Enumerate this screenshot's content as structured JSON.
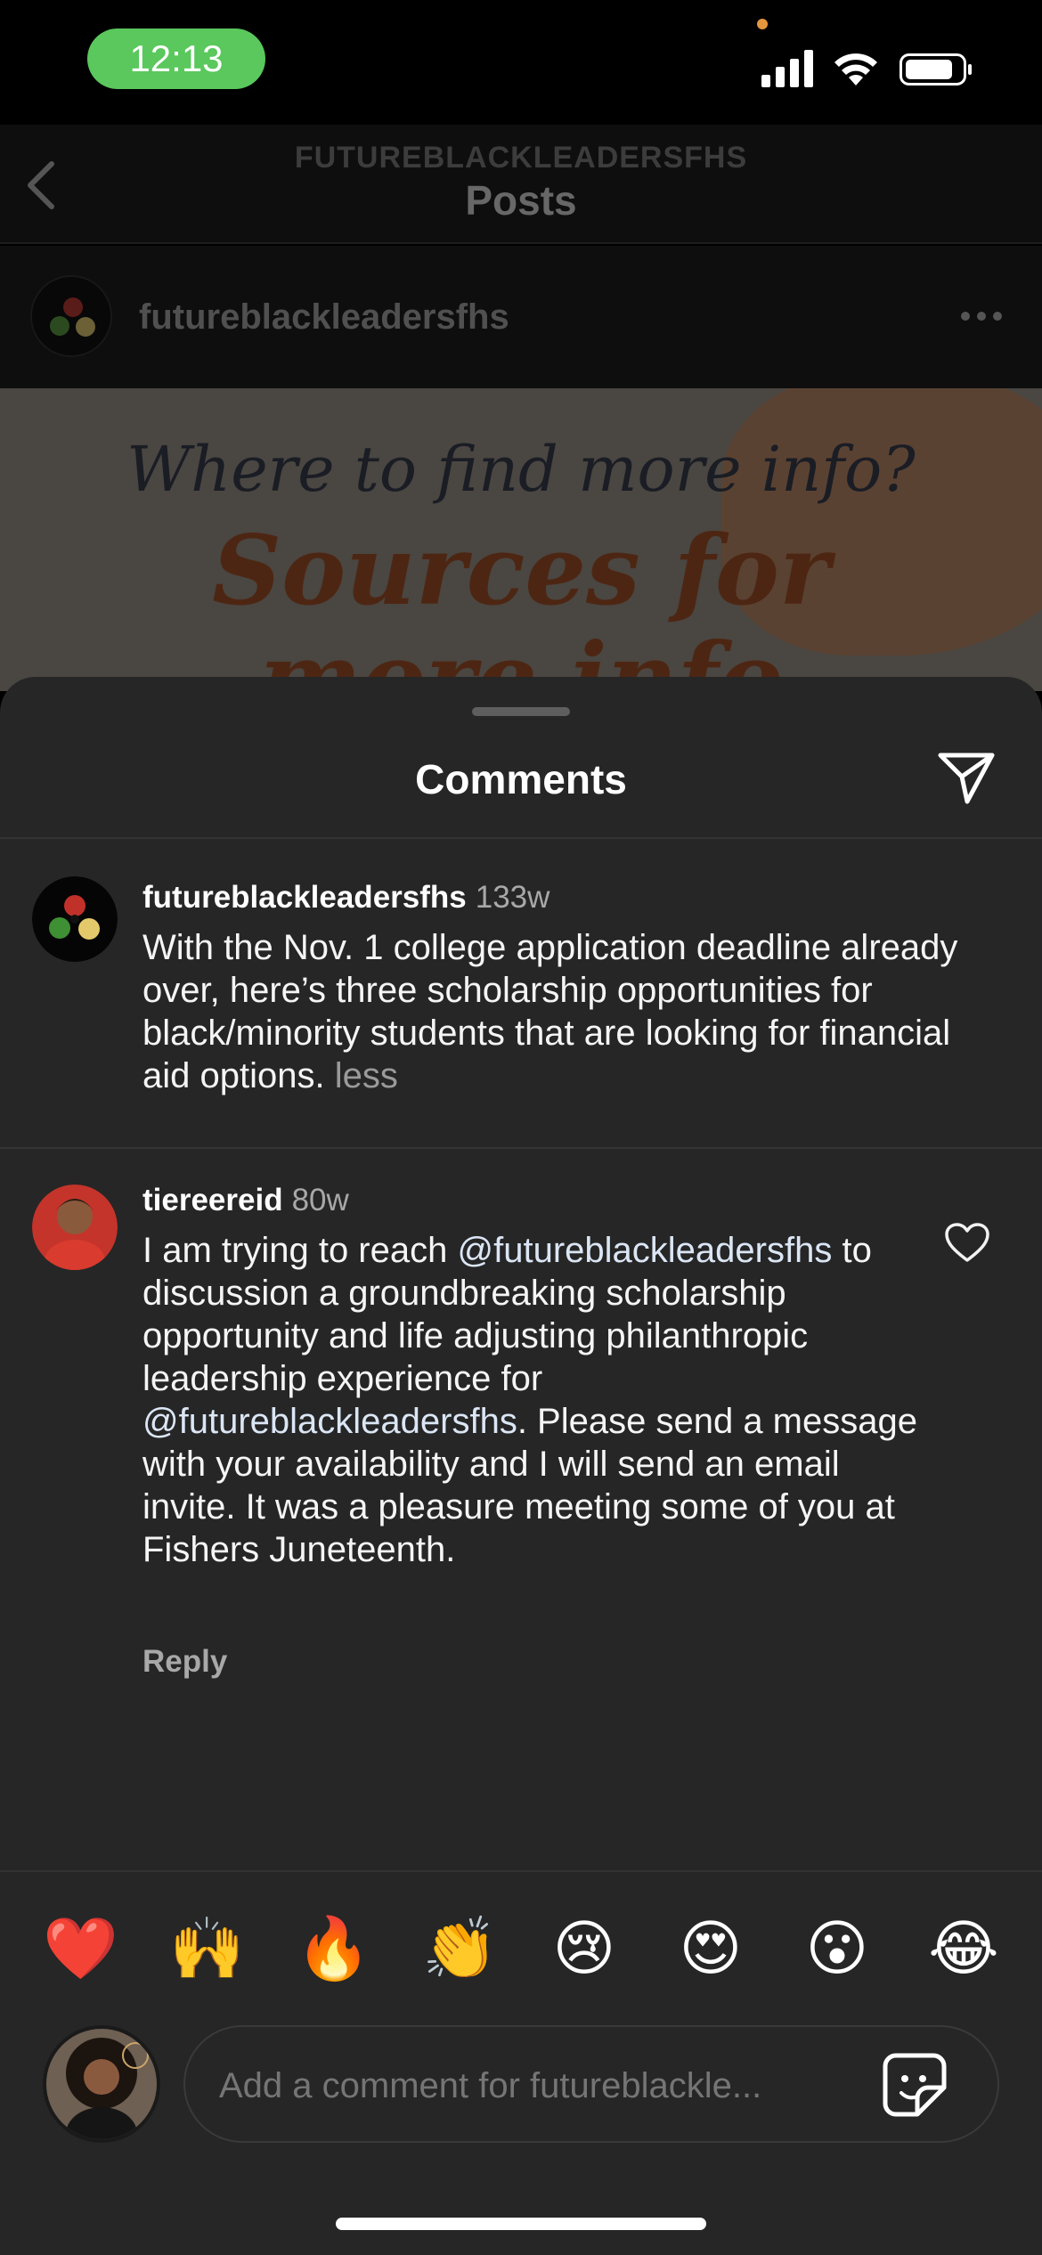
{
  "status_bar": {
    "time": "12:13"
  },
  "nav": {
    "username_caps": "FUTUREBLACKLEADERSFHS",
    "title": "Posts"
  },
  "post": {
    "username": "futureblackleadersfhs",
    "image_script_text": "Where to find more info?",
    "image_headline_1": "Sources for",
    "image_headline_2": "more info"
  },
  "comments_sheet": {
    "title": "Comments",
    "comments": [
      {
        "username": "futureblackleadersfhs",
        "age": "133w",
        "text": "With the Nov. 1 college application deadline already over, here’s three scholarship opportunities for black/minority students that are looking for financial aid options.",
        "toggle": "less"
      },
      {
        "username": "tiereereid",
        "age": "80w",
        "text_1": "I am trying to reach",
        "mention_1": "@futureblackleadersfhs",
        "text_2": "to discussion a groundbreaking scholarship opportunity and life adjusting philanthropic leadership experience for",
        "mention_2": "@futureblackleadersfhs",
        "text_3": ". Please send a message with your availability and I will send an email invite. It was a pleasure meeting some of you at Fishers Juneteenth.",
        "reply_label": "Reply"
      }
    ]
  },
  "emoji_bar": [
    "❤️",
    "🙌",
    "🔥",
    "👏",
    "😢",
    "😍",
    "😮",
    "😂"
  ],
  "composer": {
    "placeholder": "Add a comment for futureblackle..."
  },
  "colors": {
    "sheet_bg": "#262626",
    "time_pill": "#5ac85c",
    "mention": "#dbe6f5"
  }
}
